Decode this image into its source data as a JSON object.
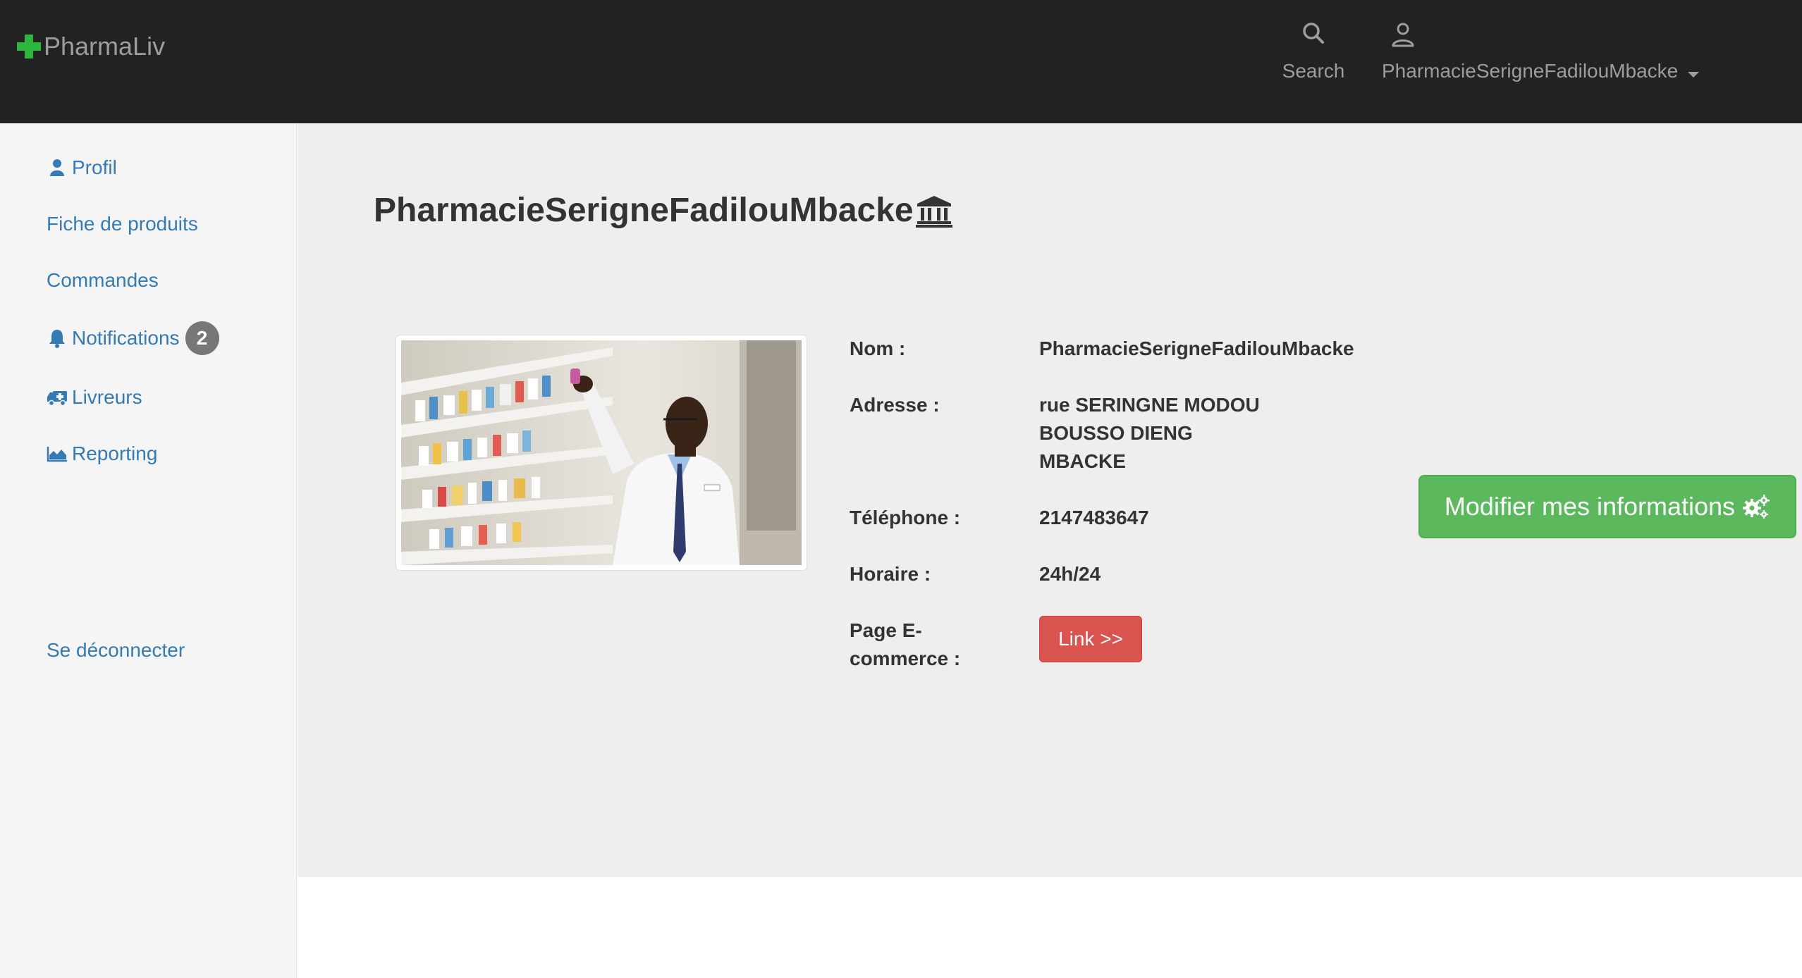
{
  "brand": {
    "name": "PharmaLiv"
  },
  "topnav": {
    "search_label": "Search",
    "user_label": "PharmacieSerigneFadilouMbacke"
  },
  "sidebar": {
    "items": [
      {
        "label": "Profil",
        "icon": "user-icon"
      },
      {
        "label": "Fiche de produits"
      },
      {
        "label": "Commandes"
      },
      {
        "label": "Notifications",
        "icon": "bell-icon",
        "badge": "2"
      },
      {
        "label": "Livreurs",
        "icon": "ambulance-icon"
      },
      {
        "label": "Reporting",
        "icon": "area-chart-icon"
      }
    ],
    "logout_label": "Se déconnecter"
  },
  "main": {
    "title": "PharmacieSerigneFadilouMbacke",
    "title_icon": "bank-icon",
    "info": {
      "nom_label": "Nom :",
      "nom_value": "PharmacieSerigneFadilouMbacke",
      "adresse_label": "Adresse :",
      "adresse_line1": "rue SERINGNE MODOU",
      "adresse_line2": "BOUSSO DIENG",
      "adresse_line3": "MBACKE",
      "telephone_label": "Téléphone :",
      "telephone_value": "2147483647",
      "horaire_label": "Horaire :",
      "horaire_value": "24h/24",
      "page_label_line1": "Page E-",
      "page_label_line2": "commerce :",
      "link_label": "Link >>"
    },
    "edit_button_label": "Modifier mes informations",
    "colors": {
      "primary_link": "#337ab7",
      "success": "#5cb85c",
      "danger": "#d9534f",
      "navbar": "#222222",
      "brand_cross": "#2db83d"
    }
  }
}
